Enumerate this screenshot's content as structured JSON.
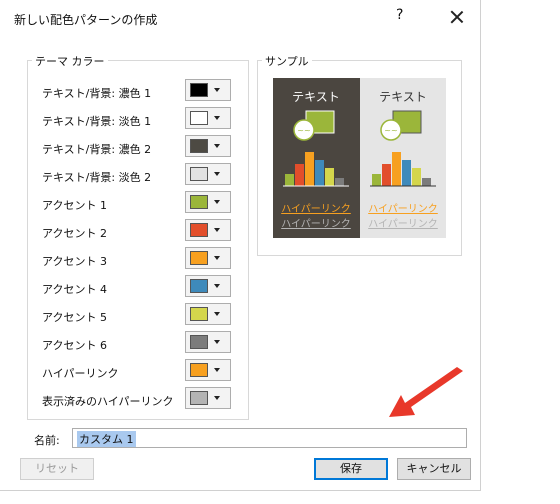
{
  "dialog": {
    "title": "新しい配色パターンの作成",
    "help": "?"
  },
  "theme_colors": {
    "legend": "テーマ カラー",
    "rows": [
      {
        "label": "テキスト/背景: 濃色 1",
        "color": "#000000"
      },
      {
        "label": "テキスト/背景: 淡色 1",
        "color": "#ffffff"
      },
      {
        "label": "テキスト/背景: 濃色 2",
        "color": "#4d4a43"
      },
      {
        "label": "テキスト/背景: 淡色 2",
        "color": "#e2e2e2"
      },
      {
        "label": "アクセント 1",
        "color": "#9bb63a"
      },
      {
        "label": "アクセント 2",
        "color": "#e24e2b"
      },
      {
        "label": "アクセント 3",
        "color": "#f7a020"
      },
      {
        "label": "アクセント 4",
        "color": "#3e8abb"
      },
      {
        "label": "アクセント 5",
        "color": "#d4d64c"
      },
      {
        "label": "アクセント 6",
        "color": "#7c7c7c"
      },
      {
        "label": "ハイパーリンク",
        "color": "#f7a020"
      },
      {
        "label": "表示済みのハイパーリンク",
        "color": "#b4b4b4"
      }
    ]
  },
  "sample": {
    "legend": "サンプル",
    "text": "テキスト",
    "hyperlink": "ハイパーリンク",
    "visited": "ハイパーリンク",
    "bar_colors": [
      "#9bb63a",
      "#e24e2b",
      "#f7a020",
      "#3e8abb",
      "#d4d64c",
      "#7c7c7c"
    ]
  },
  "name": {
    "label": "名前:",
    "value": "カスタム 1"
  },
  "buttons": {
    "reset": "リセット",
    "save": "保存",
    "cancel": "キャンセル"
  },
  "accent_arrow_color": "#e8382a"
}
